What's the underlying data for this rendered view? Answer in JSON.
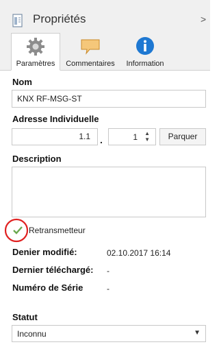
{
  "header": {
    "title": "Propriétés",
    "collapse_icon": "chevron-right-icon"
  },
  "tabs": [
    {
      "label": "Paramètres",
      "icon": "gear-icon",
      "active": true
    },
    {
      "label": "Commentaires",
      "icon": "comment-icon",
      "active": false
    },
    {
      "label": "Information",
      "icon": "info-icon",
      "active": false
    }
  ],
  "name": {
    "label": "Nom",
    "value": "KNX RF-MSG-ST"
  },
  "address": {
    "label": "Adresse Individuelle",
    "area_line": "1.1",
    "separator": ".",
    "device": "1",
    "park_button": "Parquer"
  },
  "description": {
    "label": "Description",
    "value": ""
  },
  "retransmitter": {
    "label": "Retransmetteur",
    "checked": true
  },
  "info": {
    "last_modified_label": "Denier modifié:",
    "last_modified_value": "02.10.2017 16:14",
    "last_downloaded_label": "Dernier téléchargé:",
    "last_downloaded_value": "-",
    "serial_label": "Numéro de Série",
    "serial_value": "-"
  },
  "status": {
    "label": "Statut",
    "value": "Inconnu"
  },
  "colors": {
    "highlight_circle": "#e02020",
    "check": "#6aa84f",
    "info_blue": "#1e78d2",
    "comment_orange": "#f5c77a"
  }
}
